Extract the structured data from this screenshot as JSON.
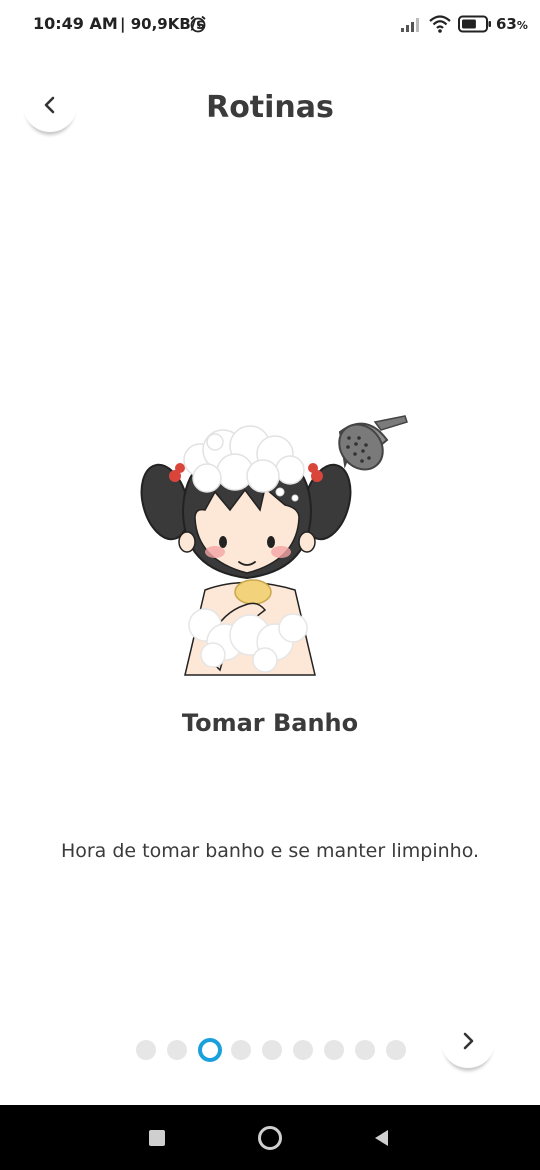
{
  "status_bar": {
    "time": "10:49 AM",
    "speed": "| 90,9KB/s",
    "battery_percent": "63",
    "battery_unit": "%",
    "battery_level": 0.63,
    "icons": [
      "alarm-icon",
      "signal-icon",
      "wifi-icon",
      "battery-icon"
    ]
  },
  "header": {
    "title": "Rotinas",
    "back_icon": "chevron-left-icon"
  },
  "routine": {
    "name": "Tomar Banho",
    "description": "Hora de tomar banho e se manter limpinho.",
    "illustration": "girl-showering-illustration"
  },
  "pagination": {
    "total": 9,
    "current": 3,
    "active_color": "#1aa0dc",
    "inactive_color": "#e6e6e6",
    "next_icon": "chevron-right-icon"
  },
  "nav_bar": {
    "icons": [
      "recent-apps-icon",
      "home-icon",
      "back-icon"
    ]
  }
}
